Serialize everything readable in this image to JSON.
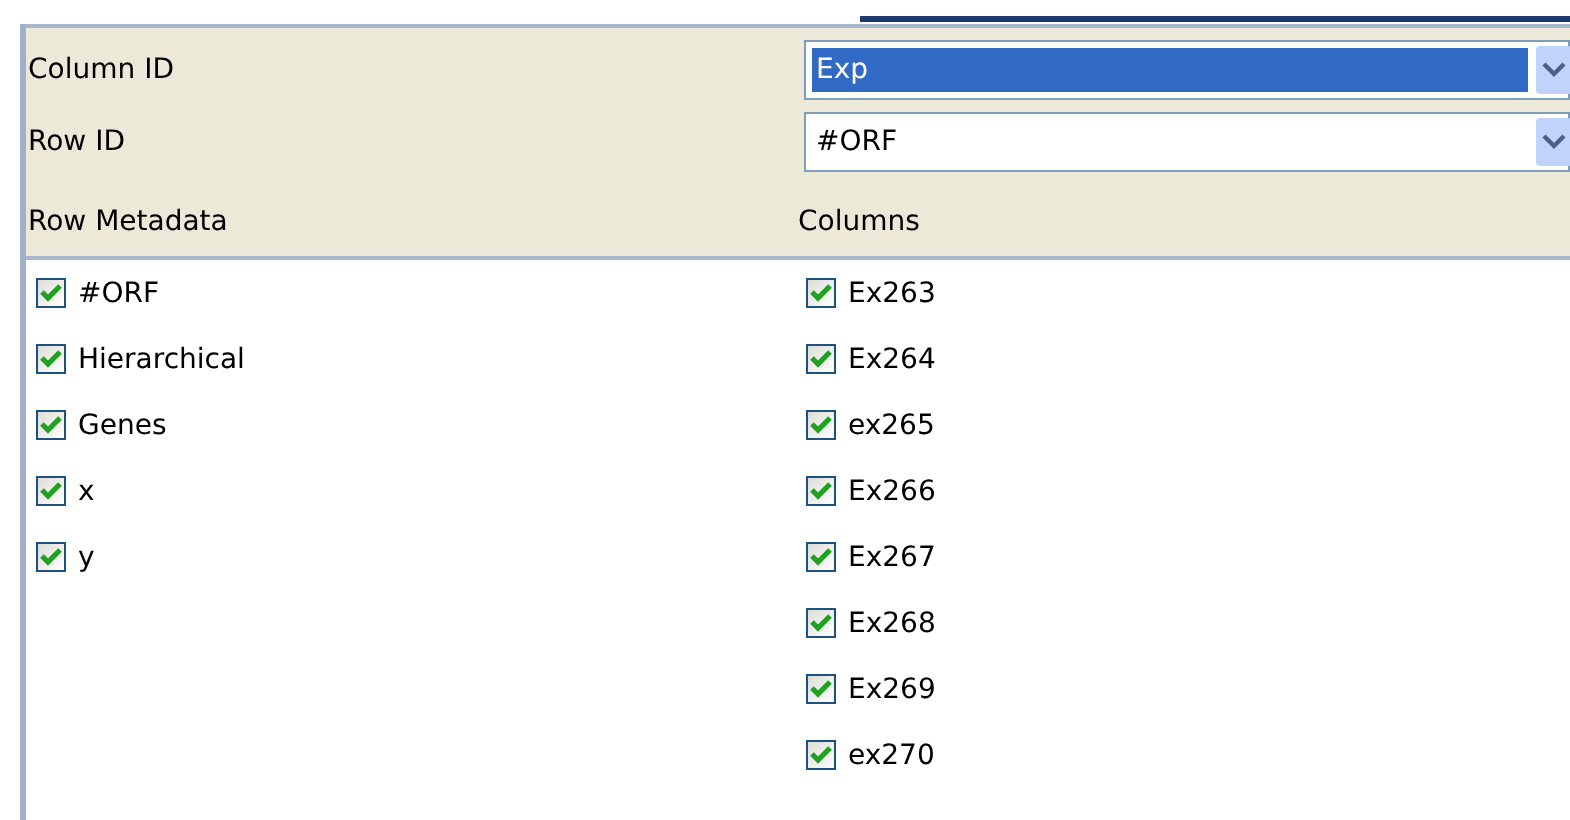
{
  "fields": [
    {
      "label": "Column ID",
      "value": "Exp",
      "focused": true
    },
    {
      "label": "Row ID",
      "value": "#ORF",
      "focused": false
    }
  ],
  "lists": [
    {
      "heading": "Row Metadata",
      "items": [
        {
          "label": "#ORF",
          "checked": true
        },
        {
          "label": "Hierarchical",
          "checked": true
        },
        {
          "label": "Genes",
          "checked": true
        },
        {
          "label": "x",
          "checked": true
        },
        {
          "label": "y",
          "checked": true
        }
      ]
    },
    {
      "heading": "Columns",
      "items": [
        {
          "label": "Ex263",
          "checked": true
        },
        {
          "label": "Ex264",
          "checked": true
        },
        {
          "label": "ex265",
          "checked": true
        },
        {
          "label": "Ex266",
          "checked": true
        },
        {
          "label": "Ex267",
          "checked": true
        },
        {
          "label": "Ex268",
          "checked": true
        },
        {
          "label": "Ex269",
          "checked": true
        },
        {
          "label": "ex270",
          "checked": true
        }
      ]
    }
  ]
}
